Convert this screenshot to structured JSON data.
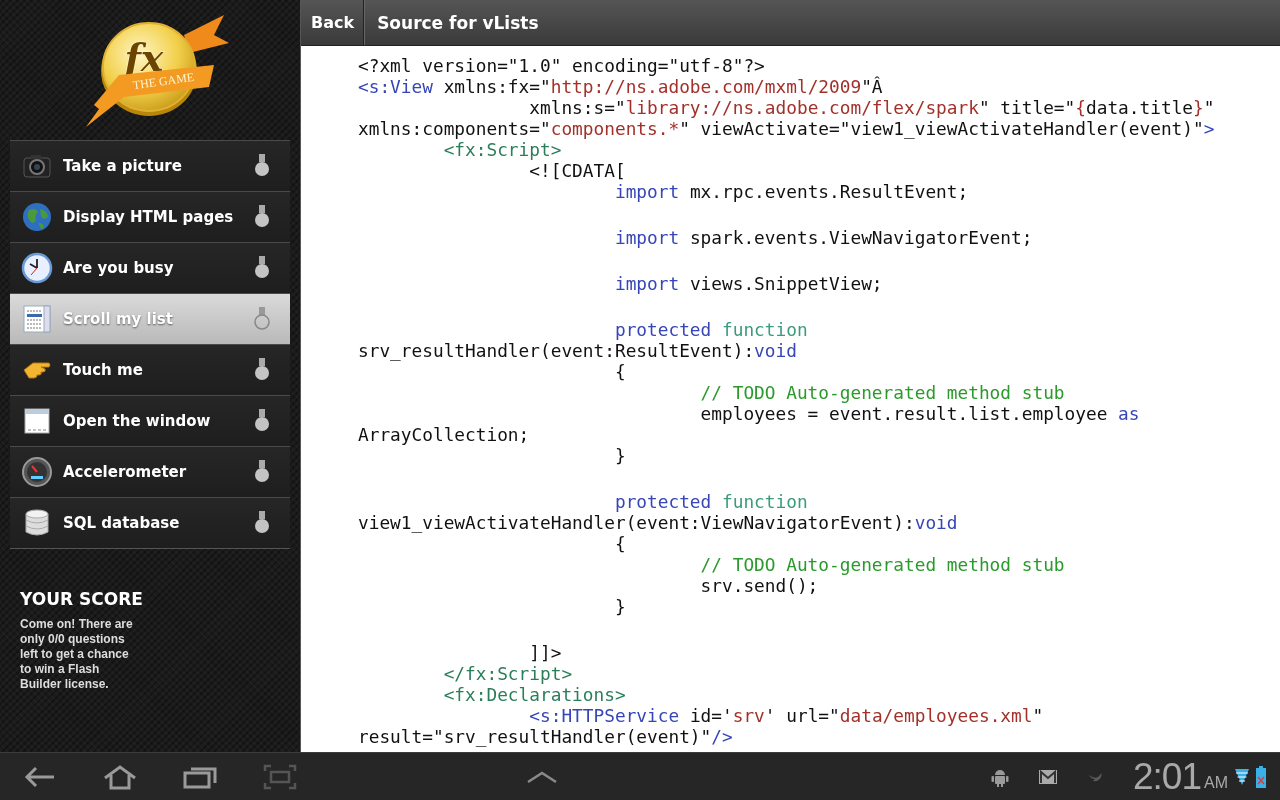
{
  "sidebar": {
    "logo": {
      "mark": "fx",
      "banner": "THE GAME"
    },
    "items": [
      {
        "label": "Take a picture",
        "kind": "camera",
        "selected": false
      },
      {
        "label": "Display HTML pages",
        "kind": "globe",
        "selected": false
      },
      {
        "label": "Are you busy",
        "kind": "clock",
        "selected": false
      },
      {
        "label": "Scroll my list",
        "kind": "list",
        "selected": true
      },
      {
        "label": "Touch me",
        "kind": "hand",
        "selected": false
      },
      {
        "label": "Open the window",
        "kind": "window",
        "selected": false
      },
      {
        "label": "Accelerometer",
        "kind": "gauge",
        "selected": false
      },
      {
        "label": "SQL database",
        "kind": "database",
        "selected": false
      }
    ],
    "score": {
      "title": "YOUR SCORE",
      "text": "Come on! There are only 0/0 questions left to get a chance to win a Flash Builder license."
    }
  },
  "header": {
    "back": "Back",
    "title": "Source for vLists"
  },
  "code": {
    "lines": [
      {
        "kind": "code",
        "segments": [
          {
            "kind": "plain",
            "text": "<?xml version=\"1.0\" encoding=\"utf-8\"?>"
          }
        ]
      },
      {
        "kind": "code",
        "segments": [
          {
            "kind": "tag",
            "text": "<s:View"
          },
          {
            "kind": "plain",
            "text": " xmlns:fx=\""
          },
          {
            "kind": "string",
            "text": "http://ns.adobe.com/mxml/2009"
          },
          {
            "kind": "plain",
            "text": "\"Â"
          }
        ]
      },
      {
        "kind": "code",
        "segments": [
          {
            "kind": "plain",
            "text": "                xmlns:s=\""
          },
          {
            "kind": "string",
            "text": "library://ns.adobe.com/flex/spark"
          },
          {
            "kind": "plain",
            "text": "\" title=\""
          },
          {
            "kind": "string",
            "text": "{"
          },
          {
            "kind": "plain",
            "text": "data.title"
          },
          {
            "kind": "string",
            "text": "}"
          },
          {
            "kind": "plain",
            "text": "\""
          }
        ]
      },
      {
        "kind": "code",
        "segments": [
          {
            "kind": "plain",
            "text": "xmlns:components=\""
          },
          {
            "kind": "string",
            "text": "components.*"
          },
          {
            "kind": "plain",
            "text": "\" viewActivate=\"view1_viewActivateHandler(event)\""
          },
          {
            "kind": "tag",
            "text": ">"
          }
        ]
      },
      {
        "kind": "code",
        "segments": [
          {
            "kind": "fxtag",
            "text": "        <fx:Script>"
          }
        ]
      },
      {
        "kind": "code",
        "segments": [
          {
            "kind": "plain",
            "text": "                <![CDATA["
          }
        ]
      },
      {
        "kind": "code",
        "segments": [
          {
            "kind": "keyword",
            "text": "                        import"
          },
          {
            "kind": "plain",
            "text": " mx.rpc.events.ResultEvent;"
          }
        ]
      },
      {
        "kind": "blank"
      },
      {
        "kind": "code",
        "segments": [
          {
            "kind": "keyword",
            "text": "                        import"
          },
          {
            "kind": "plain",
            "text": " spark.events.ViewNavigatorEvent;"
          }
        ]
      },
      {
        "kind": "blank"
      },
      {
        "kind": "code",
        "segments": [
          {
            "kind": "keyword",
            "text": "                        import"
          },
          {
            "kind": "plain",
            "text": " views.SnippetView;"
          }
        ]
      },
      {
        "kind": "blank"
      },
      {
        "kind": "code",
        "segments": [
          {
            "kind": "keyword",
            "text": "                        protected"
          },
          {
            "kind": "function",
            "text": " function"
          }
        ]
      },
      {
        "kind": "code",
        "segments": [
          {
            "kind": "plain",
            "text": "srv_resultHandler(event:ResultEvent):"
          },
          {
            "kind": "keyword",
            "text": "void"
          }
        ]
      },
      {
        "kind": "code",
        "segments": [
          {
            "kind": "plain",
            "text": "                        {"
          }
        ]
      },
      {
        "kind": "code",
        "segments": [
          {
            "kind": "comment",
            "text": "                                // TODO Auto-generated method stub"
          }
        ]
      },
      {
        "kind": "code",
        "segments": [
          {
            "kind": "plain",
            "text": "                                employees = event.result.list.employee "
          },
          {
            "kind": "keyword",
            "text": "as"
          }
        ]
      },
      {
        "kind": "code",
        "segments": [
          {
            "kind": "plain",
            "text": "ArrayCollection;"
          }
        ]
      },
      {
        "kind": "code",
        "segments": [
          {
            "kind": "plain",
            "text": "                        }"
          }
        ]
      },
      {
        "kind": "blank"
      },
      {
        "kind": "code",
        "segments": [
          {
            "kind": "keyword",
            "text": "                        protected"
          },
          {
            "kind": "function",
            "text": " function"
          }
        ]
      },
      {
        "kind": "code",
        "segments": [
          {
            "kind": "plain",
            "text": "view1_viewActivateHandler(event:ViewNavigatorEvent):"
          },
          {
            "kind": "keyword",
            "text": "void"
          }
        ]
      },
      {
        "kind": "code",
        "segments": [
          {
            "kind": "plain",
            "text": "                        {"
          }
        ]
      },
      {
        "kind": "code",
        "segments": [
          {
            "kind": "comment",
            "text": "                                // TODO Auto-generated method stub"
          }
        ]
      },
      {
        "kind": "code",
        "segments": [
          {
            "kind": "plain",
            "text": "                                srv.send();"
          }
        ]
      },
      {
        "kind": "code",
        "segments": [
          {
            "kind": "plain",
            "text": "                        }"
          }
        ]
      },
      {
        "kind": "blank"
      },
      {
        "kind": "code",
        "segments": [
          {
            "kind": "plain",
            "text": "                ]]>"
          }
        ]
      },
      {
        "kind": "code",
        "segments": [
          {
            "kind": "fxtag",
            "text": "        </fx:Script>"
          }
        ]
      },
      {
        "kind": "code",
        "segments": [
          {
            "kind": "fxtag",
            "text": "        <fx:Declarations>"
          }
        ]
      },
      {
        "kind": "code",
        "segments": [
          {
            "kind": "tag",
            "text": "                <s:HTTPService"
          },
          {
            "kind": "plain",
            "text": " id='"
          },
          {
            "kind": "string",
            "text": "srv"
          },
          {
            "kind": "plain",
            "text": "' url=\""
          },
          {
            "kind": "string",
            "text": "data/employees.xml"
          },
          {
            "kind": "plain",
            "text": "\""
          }
        ]
      },
      {
        "kind": "code",
        "segments": [
          {
            "kind": "plain",
            "text": "result=\"srv_resultHandler(event)\""
          },
          {
            "kind": "tag",
            "text": "/>"
          }
        ]
      }
    ]
  },
  "system_bar": {
    "time": "2:01",
    "meridiem": "AM"
  }
}
